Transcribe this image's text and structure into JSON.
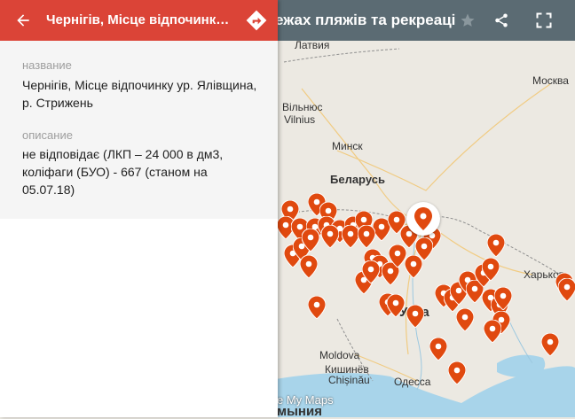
{
  "map": {
    "title": "ежах пляжів та рекреаці",
    "logo": "e My Maps",
    "cities": [
      {
        "name": "Латвия",
        "bold": false
      },
      {
        "name": "Вільнюс",
        "bold": false
      },
      {
        "name": "Vilnius",
        "bold": false
      },
      {
        "name": "Минск",
        "bold": false
      },
      {
        "name": "Беларусь",
        "bold": true
      },
      {
        "name": "Москва",
        "bold": false
      },
      {
        "name": "Харьков",
        "bold": false
      },
      {
        "name": "Moldova",
        "bold": false
      },
      {
        "name": "Кишинёв",
        "bold": false
      },
      {
        "name": "Chișinău",
        "bold": false
      },
      {
        "name": "Одесса",
        "bold": false
      },
      {
        "name": "Укра",
        "bold": true
      },
      {
        "name": "мыния",
        "bold": true
      }
    ],
    "pins": 60
  },
  "panel": {
    "title": "Чернігів, Місце відпочинку ур....",
    "name_label": "название",
    "name_value": "Чернігів, Місце відпочинку ур. Ялівщина, р. Стрижень",
    "desc_label": "описание",
    "desc_value": "не відповідає (ЛКП – 24 000 в дм3, коліфаги (БУО) - 667 (станом на 05.07.18)"
  },
  "colors": {
    "header_red": "#db4437",
    "topbar": "#5b6b73",
    "pin": "#e0490f"
  },
  "icons": {
    "back": "arrow-left-icon",
    "directions": "directions-icon",
    "star": "star-icon",
    "share": "share-icon",
    "fullscreen": "fullscreen-icon"
  }
}
